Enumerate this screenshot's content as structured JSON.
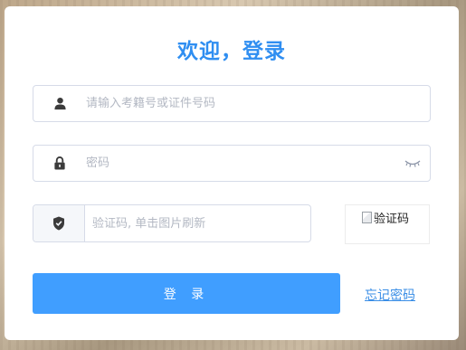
{
  "login": {
    "title": "欢迎，登录",
    "username": {
      "placeholder": "请输入考籍号或证件号码",
      "icon": "user-icon"
    },
    "password": {
      "placeholder": "密码",
      "icon": "lock-icon",
      "toggle_icon": "eye-closed-icon"
    },
    "captcha": {
      "placeholder": "验证码, 单击图片刷新",
      "icon": "shield-icon",
      "image_alt": "验证码"
    },
    "submit_label": "登 录",
    "forgot_label": "忘记密码"
  },
  "colors": {
    "accent": "#409eff",
    "title": "#2f8ef1",
    "link": "#3a8ee6",
    "border": "#d6dbe8",
    "placeholder": "#b3b8c3"
  }
}
